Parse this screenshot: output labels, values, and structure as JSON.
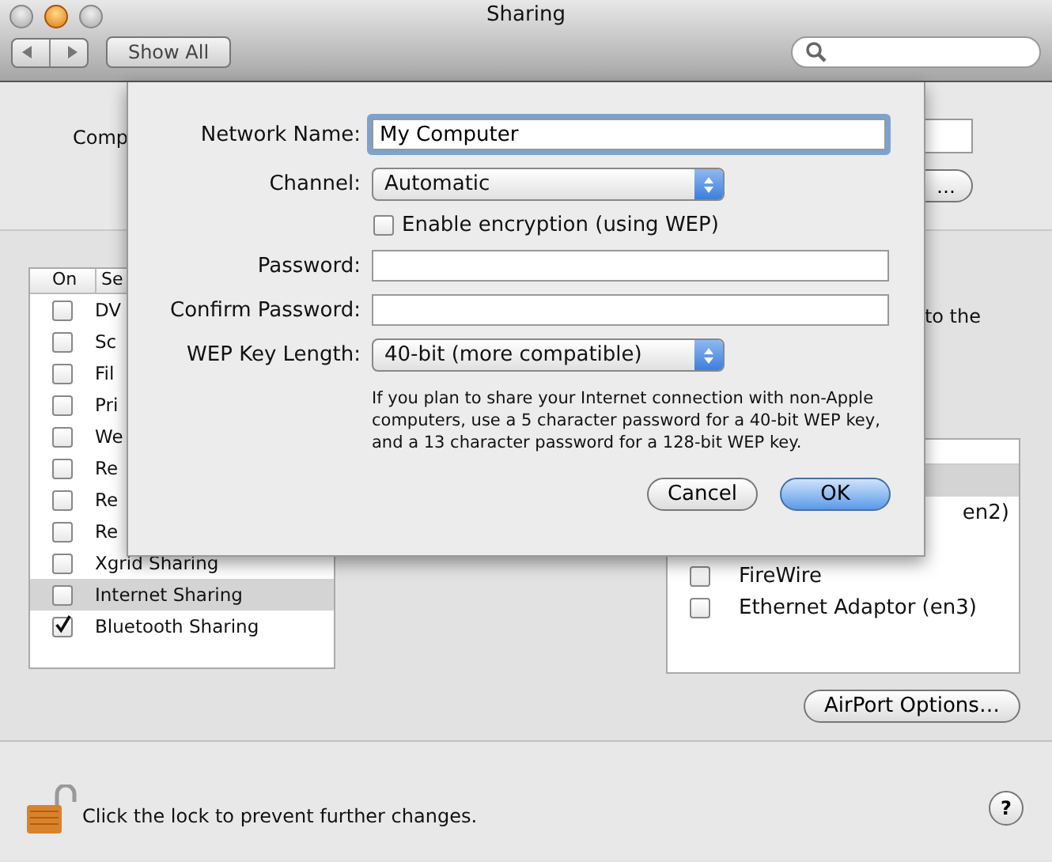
{
  "window": {
    "title": "Sharing"
  },
  "toolbar": {
    "show_all": "Show All"
  },
  "computer_name": {
    "label": "Comp",
    "edit_button": "…"
  },
  "services": {
    "columns": [
      "On",
      "Se"
    ],
    "rows": [
      {
        "name": "DV",
        "on": false,
        "selected": false
      },
      {
        "name": "Sc",
        "on": false,
        "selected": false
      },
      {
        "name": "Fil",
        "on": false,
        "selected": false
      },
      {
        "name": "Pri",
        "on": false,
        "selected": false
      },
      {
        "name": "We",
        "on": false,
        "selected": false
      },
      {
        "name": "Re",
        "on": false,
        "selected": false
      },
      {
        "name": "Re",
        "on": false,
        "selected": false
      },
      {
        "name": "Re",
        "on": false,
        "selected": false
      },
      {
        "name": "Xgrid Sharing",
        "on": false,
        "selected": false
      },
      {
        "name": "Internet Sharing",
        "on": false,
        "selected": true
      },
      {
        "name": "Bluetooth Sharing",
        "on": true,
        "selected": false
      }
    ]
  },
  "description_fragment": "to the",
  "ports": {
    "rows": [
      {
        "selected": true
      },
      {
        "name": "en2)",
        "selected": false
      },
      {
        "selected": false
      },
      {
        "name": "FireWire",
        "checked": false,
        "selected": false
      },
      {
        "name": "Ethernet Adaptor (en3)",
        "checked": false,
        "selected": false
      }
    ]
  },
  "airport_options": "AirPort Options…",
  "lock": {
    "locked": false,
    "text": "Click the lock to prevent further changes."
  },
  "help": "?",
  "sheet": {
    "network_name": {
      "label": "Network Name:",
      "value": "My Computer"
    },
    "channel": {
      "label": "Channel:",
      "value": "Automatic"
    },
    "encryption": {
      "label": "Enable encryption (using WEP)",
      "checked": false
    },
    "password": {
      "label": "Password:"
    },
    "confirm_password": {
      "label": "Confirm Password:"
    },
    "wep_key_length": {
      "label": "WEP Key Length:",
      "value": "40-bit (more compatible)"
    },
    "note": "If you plan to share your Internet connection with non-Apple computers, use a 5 character password for a 40-bit WEP key, and a 13 character password for a 128-bit WEP key.",
    "buttons": [
      {
        "label": "Cancel",
        "default": false
      },
      {
        "label": "OK",
        "default": true
      }
    ]
  }
}
